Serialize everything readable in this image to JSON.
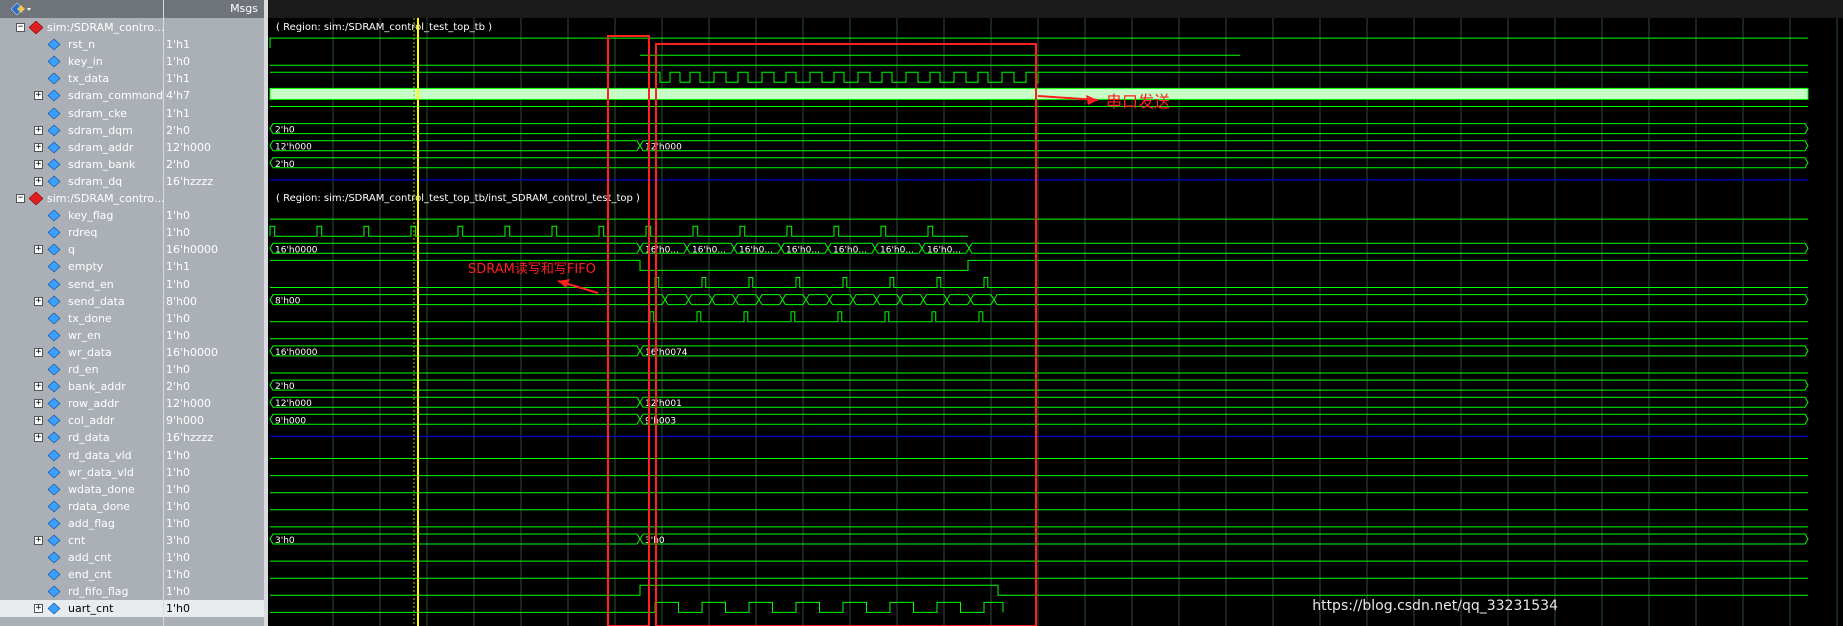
{
  "header": {
    "msgs_label": "Msgs"
  },
  "colors": {
    "wave_green": "#00ff00",
    "bus_fill": "#c8ffc8",
    "hiz_blue": "#0000ff",
    "cursor_yellow": "#ffff00",
    "annotation_red": "#ff2020",
    "grid": "#2f4f2f"
  },
  "icons": {
    "group": "red-diamond-module-icon",
    "signal": "blue-diamond-signal-icon",
    "toolbar": "signals-dropdown-icon"
  },
  "signals": [
    {
      "name": "sim:/SDRAM_contro...",
      "value": "",
      "group": true,
      "region": "( Region: sim:/SDRAM_control_test_top_tb )"
    },
    {
      "name": "rst_n",
      "value": "1'h1",
      "wave": "rst"
    },
    {
      "name": "key_in",
      "value": "1'h0",
      "wave": "keyin"
    },
    {
      "name": "tx_data",
      "value": "1'h1",
      "wave": "txdata"
    },
    {
      "name": "sdram_commond",
      "value": "4'h7",
      "expand": true,
      "wave": "dense"
    },
    {
      "name": "sdram_cke",
      "value": "1'h1",
      "wave": "high"
    },
    {
      "name": "sdram_dqm",
      "value": "2'h0",
      "expand": true,
      "wave": "bus",
      "labels": [
        {
          "t": "2'h0"
        }
      ]
    },
    {
      "name": "sdram_addr",
      "value": "12'h000",
      "expand": true,
      "wave": "bus",
      "labels": [
        {
          "t": "12'h000"
        },
        {
          "t": "12'h000",
          "at": "A"
        }
      ]
    },
    {
      "name": "sdram_bank",
      "value": "2'h0",
      "expand": true,
      "wave": "bus",
      "labels": [
        {
          "t": "2'h0"
        }
      ]
    },
    {
      "name": "sdram_dq",
      "value": "16'hzzzz",
      "expand": true,
      "wave": "hiz"
    },
    {
      "name": "sim:/SDRAM_contro...",
      "value": "",
      "group": true,
      "region": "( Region: sim:/SDRAM_control_test_top_tb/inst_SDRAM_control_test_top )"
    },
    {
      "name": "key_flag",
      "value": "1'h0",
      "wave": "low"
    },
    {
      "name": "rdreq",
      "value": "1'h0",
      "wave": "rdreq"
    },
    {
      "name": "q",
      "value": "16'h0000",
      "expand": true,
      "wave": "qbus",
      "labels": [
        {
          "t": "16'h0000"
        },
        {
          "t": "16'h0..."
        },
        {
          "t": "16'h0..."
        },
        {
          "t": "16'h0..."
        },
        {
          "t": "16'h0..."
        },
        {
          "t": "16'h0..."
        },
        {
          "t": "16'h0..."
        },
        {
          "t": "16'h0..."
        }
      ]
    },
    {
      "name": "empty",
      "value": "1'h1",
      "wave": "empty"
    },
    {
      "name": "send_en",
      "value": "1'h0",
      "wave": "sendpulse"
    },
    {
      "name": "send_data",
      "value": "8'h00",
      "expand": true,
      "wave": "sendbus",
      "labels": [
        {
          "t": "8'h00"
        }
      ]
    },
    {
      "name": "tx_done",
      "value": "1'h0",
      "wave": "txdone"
    },
    {
      "name": "wr_en",
      "value": "1'h0",
      "wave": "low"
    },
    {
      "name": "wr_data",
      "value": "16'h0000",
      "expand": true,
      "wave": "bus",
      "labels": [
        {
          "t": "16'h0000"
        },
        {
          "t": "16'h0074",
          "at": "A"
        }
      ]
    },
    {
      "name": "rd_en",
      "value": "1'h0",
      "wave": "low"
    },
    {
      "name": "bank_addr",
      "value": "2'h0",
      "expand": true,
      "wave": "bus",
      "labels": [
        {
          "t": "2'h0"
        }
      ]
    },
    {
      "name": "row_addr",
      "value": "12'h000",
      "expand": true,
      "wave": "bus",
      "labels": [
        {
          "t": "12'h000"
        },
        {
          "t": "12'h001",
          "at": "A"
        }
      ]
    },
    {
      "name": "col_addr",
      "value": "9'h000",
      "expand": true,
      "wave": "bus",
      "labels": [
        {
          "t": "9'h000"
        },
        {
          "t": "9'h003",
          "at": "A"
        }
      ]
    },
    {
      "name": "rd_data",
      "value": "16'hzzzz",
      "expand": true,
      "wave": "hiz"
    },
    {
      "name": "rd_data_vld",
      "value": "1'h0",
      "wave": "low"
    },
    {
      "name": "wr_data_vld",
      "value": "1'h0",
      "wave": "low"
    },
    {
      "name": "wdata_done",
      "value": "1'h0",
      "wave": "low"
    },
    {
      "name": "rdata_done",
      "value": "1'h0",
      "wave": "low"
    },
    {
      "name": "add_flag",
      "value": "1'h0",
      "wave": "low"
    },
    {
      "name": "cnt",
      "value": "3'h0",
      "expand": true,
      "wave": "bus",
      "labels": [
        {
          "t": "3'h0"
        },
        {
          "t": "3'h0",
          "at": "A"
        }
      ]
    },
    {
      "name": "add_cnt",
      "value": "1'h0",
      "wave": "low"
    },
    {
      "name": "end_cnt",
      "value": "1'h0",
      "wave": "low"
    },
    {
      "name": "rd_fifo_flag",
      "value": "1'h0",
      "wave": "fifoflag"
    },
    {
      "name": "uart_cnt",
      "value": "1'h0",
      "expand": true,
      "wave": "uartcnt",
      "selected": true
    }
  ],
  "annotations": {
    "uart_send": "串口发送",
    "sdram_fifo": "SDRAM读写和写FIFO",
    "watermark": "https://blog.csdn.net/qq_33231534"
  }
}
